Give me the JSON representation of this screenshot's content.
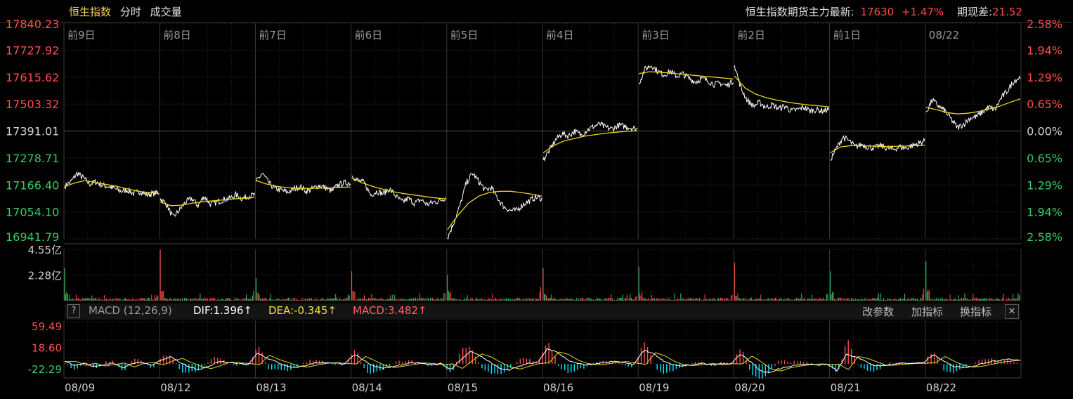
{
  "header": {
    "tabs": [
      "恒生指数",
      "分时",
      "成交量"
    ],
    "futures_label": "恒生指数期货主力最新:",
    "futures_price": "17630",
    "futures_change": "+1.47%",
    "spread_label": "期现差:",
    "spread_value": "21.52"
  },
  "macd_bar": {
    "help": "?",
    "title": "MACD (12,26,9)",
    "dif": "DIF:1.396↑",
    "dea": "DEA:-0.345↑",
    "macd": "MACD:3.482↑",
    "buttons": [
      "改参数",
      "加指标",
      "换指标"
    ],
    "close": "✕"
  },
  "colors": {
    "up": "#ff4d4d",
    "down": "#33cc66",
    "price_line": "#ffffff",
    "avg_line": "#e8d51c",
    "dif_line": "#ffffff",
    "dea_line": "#e8d51c",
    "macd_neg": "#00e5ff",
    "grid": "#262626",
    "label_dim": "#cfcfcf"
  },
  "chart_data": {
    "type": "line",
    "day_labels": [
      "前9日",
      "前8日",
      "前7日",
      "前6日",
      "前5日",
      "前4日",
      "前3日",
      "前2日",
      "前1日",
      "08/22"
    ],
    "dates": [
      "08/09",
      "08/12",
      "08/13",
      "08/14",
      "08/15",
      "08/16",
      "08/19",
      "08/20",
      "08/21",
      "08/22"
    ],
    "y_ticks": [
      "17840.23",
      "17727.92",
      "17615.62",
      "17503.32",
      "17391.01",
      "17278.71",
      "17166.40",
      "17054.10",
      "16941.79"
    ],
    "y_tick_values": [
      17840.23,
      17727.92,
      17615.62,
      17503.32,
      17391.01,
      17278.71,
      17166.4,
      17054.1,
      16941.79
    ],
    "pct_ticks": [
      "2.58%",
      "1.94%",
      "1.29%",
      "0.65%",
      "0.00%",
      "0.65%",
      "1.29%",
      "1.94%",
      "2.58%"
    ],
    "ylim": [
      16941.79,
      17840.23
    ],
    "series": [
      {
        "name": "price",
        "days": [
          {
            "open": 17160,
            "path": [
              17180,
              17215,
              17195,
              17170,
              17180,
              17165,
              17160,
              17150,
              17140,
              17145,
              17130,
              17140,
              17125,
              17130,
              17135
            ]
          },
          {
            "open": 17110,
            "path": [
              17085,
              17030,
              17060,
              17095,
              17110,
              17080,
              17120,
              17085,
              17095,
              17105,
              17110,
              17125,
              17110,
              17120,
              17125
            ]
          },
          {
            "open": 17180,
            "path": [
              17215,
              17175,
              17150,
              17145,
              17135,
              17150,
              17160,
              17140,
              17150,
              17165,
              17155,
              17140,
              17165,
              17175,
              17175
            ]
          },
          {
            "open": 17205,
            "path": [
              17185,
              17175,
              17125,
              17140,
              17130,
              17150,
              17120,
              17095,
              17110,
              17090,
              17105,
              17085,
              17095,
              17100,
              17115
            ]
          },
          {
            "open": 16945,
            "path": [
              17010,
              17080,
              17175,
              17215,
              17180,
              17145,
              17155,
              17110,
              17075,
              17060,
              17060,
              17085,
              17100,
              17115,
              17110
            ]
          },
          {
            "open": 17270,
            "path": [
              17310,
              17355,
              17380,
              17370,
              17390,
              17375,
              17395,
              17410,
              17420,
              17405,
              17400,
              17415,
              17410,
              17405,
              17400
            ]
          },
          {
            "open": 17590,
            "path": [
              17650,
              17665,
              17640,
              17625,
              17640,
              17620,
              17630,
              17610,
              17595,
              17610,
              17600,
              17585,
              17590,
              17580,
              17600
            ]
          },
          {
            "open": 17665,
            "path": [
              17570,
              17520,
              17495,
              17510,
              17490,
              17500,
              17485,
              17495,
              17475,
              17480,
              17490,
              17475,
              17480,
              17475,
              17480
            ]
          },
          {
            "open": 17270,
            "path": [
              17320,
              17365,
              17350,
              17325,
              17335,
              17325,
              17320,
              17330,
              17320,
              17315,
              17325,
              17320,
              17330,
              17340,
              17350
            ]
          },
          {
            "open": 17470,
            "path": [
              17520,
              17495,
              17475,
              17440,
              17405,
              17420,
              17445,
              17450,
              17470,
              17490,
              17480,
              17530,
              17560,
              17600,
              17615
            ]
          }
        ]
      },
      {
        "name": "average",
        "days": [
          [
            17160,
            17175,
            17185,
            17175,
            17168,
            17160,
            17150,
            17140,
            17135,
            17130
          ],
          [
            17095,
            17080,
            17082,
            17090,
            17096,
            17100,
            17104,
            17108,
            17111,
            17114
          ],
          [
            17185,
            17170,
            17160,
            17155,
            17152,
            17152,
            17153,
            17154,
            17156,
            17158
          ],
          [
            17195,
            17175,
            17160,
            17148,
            17138,
            17130,
            17124,
            17118,
            17112,
            17108
          ],
          [
            16980,
            17040,
            17090,
            17120,
            17135,
            17140,
            17140,
            17135,
            17128,
            17120
          ],
          [
            17300,
            17330,
            17350,
            17360,
            17370,
            17376,
            17382,
            17386,
            17390,
            17392
          ],
          [
            17630,
            17638,
            17636,
            17632,
            17628,
            17624,
            17620,
            17616,
            17612,
            17608
          ],
          [
            17620,
            17570,
            17545,
            17530,
            17520,
            17512,
            17505,
            17500,
            17496,
            17492
          ],
          [
            17300,
            17325,
            17330,
            17330,
            17328,
            17327,
            17327,
            17328,
            17330,
            17332
          ],
          [
            17490,
            17480,
            17468,
            17462,
            17465,
            17472,
            17482,
            17494,
            17510,
            17525
          ]
        ]
      }
    ],
    "volume": {
      "ticks": [
        "4.55亿",
        "2.28亿"
      ],
      "tick_values": [
        4.55,
        2.28
      ],
      "unit": "亿",
      "day_open_spikes": [
        2.9,
        4.5,
        2.0,
        2.6,
        2.3,
        2.9,
        3.0,
        3.4,
        2.6,
        3.5,
        3.2
      ],
      "day_close_spikes": [
        0.6,
        0.5,
        0.5,
        0.6,
        0.8,
        0.5,
        0.5,
        0.6,
        0.7,
        0.6
      ]
    },
    "macd": {
      "ticks": [
        "59.49",
        "18.60",
        "-22.29"
      ],
      "tick_values": [
        59.49,
        18.6,
        -22.29
      ],
      "day_shapes": [
        [
          10,
          -5,
          3,
          -8,
          -2,
          4,
          -12,
          2,
          6,
          -4
        ],
        [
          12,
          22,
          5,
          -10,
          -18,
          -6,
          8,
          4,
          2,
          -3
        ],
        [
          35,
          18,
          6,
          -8,
          -12,
          -4,
          3,
          5,
          2,
          0
        ],
        [
          30,
          12,
          -6,
          -14,
          -8,
          -2,
          4,
          2,
          -3,
          1
        ],
        [
          -18,
          12,
          40,
          28,
          6,
          -12,
          -20,
          -8,
          2,
          5
        ],
        [
          48,
          38,
          15,
          2,
          -3,
          0,
          6,
          10,
          4,
          -2
        ],
        [
          45,
          32,
          10,
          -4,
          -6,
          -2,
          2,
          -3,
          1,
          0
        ],
        [
          32,
          8,
          -20,
          -28,
          -15,
          -8,
          -3,
          0,
          -2,
          -1
        ],
        [
          -22,
          30,
          22,
          8,
          -6,
          -4,
          0,
          2,
          3,
          5
        ],
        [
          30,
          10,
          -6,
          -12,
          -8,
          0,
          8,
          12,
          16,
          10
        ]
      ]
    }
  }
}
